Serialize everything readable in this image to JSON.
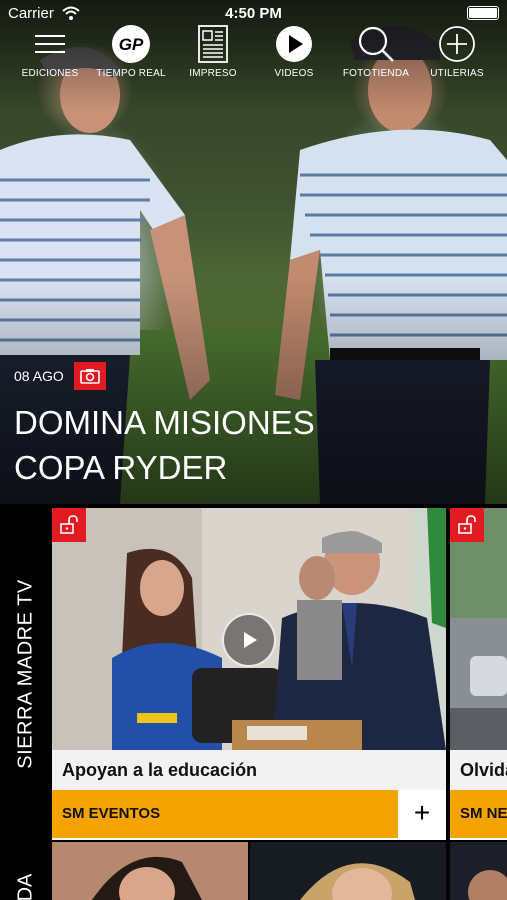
{
  "status_bar": {
    "carrier": "Carrier",
    "time": "4:50 PM"
  },
  "nav": {
    "items": [
      {
        "label": "EDICIONES",
        "icon": "hamburger-menu-icon"
      },
      {
        "label": "TIEMPO REAL",
        "icon": "gp-logo-icon"
      },
      {
        "label": "IMPRESO",
        "icon": "newspaper-icon"
      },
      {
        "label": "VIDEOS",
        "icon": "play-circle-icon"
      },
      {
        "label": "FOTOTIENDA",
        "icon": "search-icon"
      },
      {
        "label": "UTILERIAS",
        "icon": "plus-circle-icon"
      }
    ]
  },
  "hero": {
    "date": "08 AGO",
    "headline_line1": "DOMINA MISIONES",
    "headline_line2": "COPA RYDER",
    "badge_icon": "camera-icon"
  },
  "section": {
    "label": "SIERRA MADRE TV",
    "cards": [
      {
        "title": "Apoyan a la educación",
        "category": "SM EVENTOS",
        "lock_icon": "unlocked-icon",
        "play_icon": "play-icon"
      },
      {
        "title": "Olvida",
        "category": "SM NEW",
        "lock_icon": "unlocked-icon"
      }
    ],
    "plus_label": "+"
  },
  "section2": {
    "label": "DA"
  },
  "colors": {
    "accent_red": "#e21b23",
    "accent_orange": "#f5a300",
    "background": "#000000"
  }
}
